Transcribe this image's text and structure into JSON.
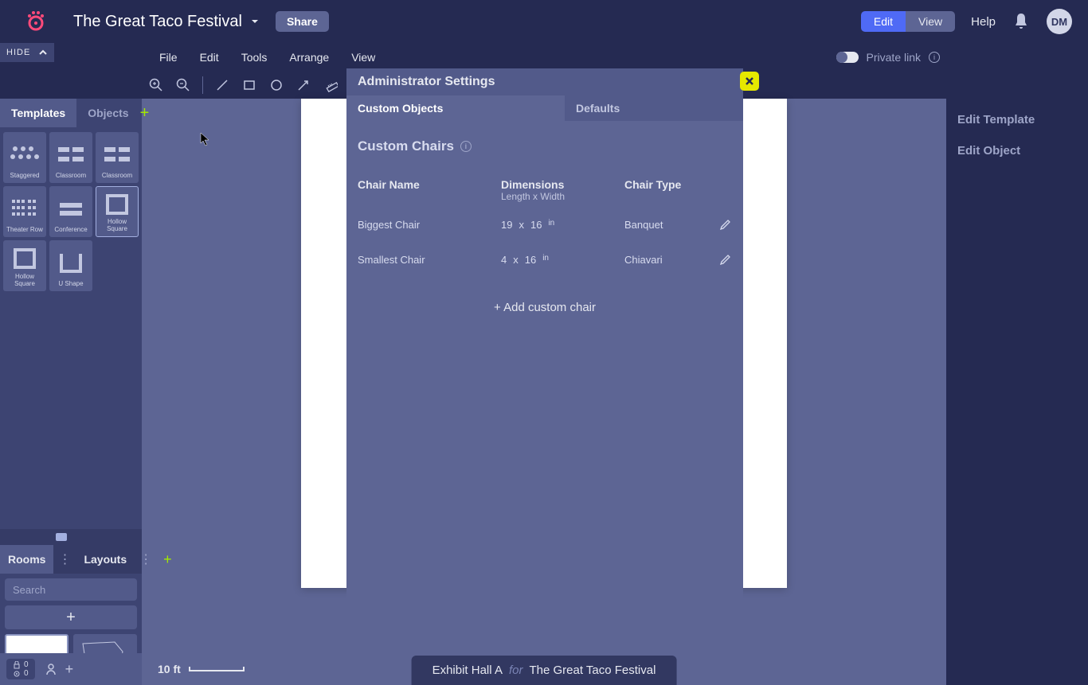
{
  "header": {
    "project_title": "The Great Taco Festival",
    "share": "Share",
    "edit": "Edit",
    "view": "View",
    "help": "Help",
    "avatar": "DM"
  },
  "hide_bar": "HIDE",
  "menu": {
    "file": "File",
    "edit": "Edit",
    "tools": "Tools",
    "arrange": "Arrange",
    "view": "View",
    "private_link": "Private link"
  },
  "sidebar": {
    "tabs": {
      "templates": "Templates",
      "objects": "Objects"
    },
    "templates": {
      "t0": "Staggered",
      "t1": "Classroom",
      "t2": "Classroom",
      "t3": "Theater Row",
      "t4": "Conference",
      "t5": "Hollow Square",
      "t6": "Hollow Square",
      "t7": "U Shape"
    }
  },
  "rooms": {
    "tabs": {
      "rooms": "Rooms",
      "layouts": "Layouts"
    },
    "search_placeholder": "Search"
  },
  "status": {
    "lock": "0",
    "gear": "0"
  },
  "right": {
    "edit_template": "Edit Template",
    "edit_object": "Edit Object"
  },
  "scale": "10 ft",
  "bottom": {
    "room": "Exhibit Hall A",
    "for": "for",
    "event": "The Great Taco Festival"
  },
  "modal": {
    "title": "Administrator Settings",
    "tab_custom": "Custom Objects",
    "tab_defaults": "Defaults",
    "section": "Custom Chairs",
    "col_name": "Chair Name",
    "col_dim": "Dimensions",
    "col_dim_sub": "Length x Width",
    "col_type": "Chair Type",
    "rows": [
      {
        "name": "Biggest Chair",
        "l": "19",
        "x": "x",
        "w": "16",
        "unit": "in",
        "type": "Banquet"
      },
      {
        "name": "Smallest Chair",
        "l": "4",
        "x": "x",
        "w": "16",
        "unit": "in",
        "type": "Chiavari"
      }
    ],
    "add": "+ Add custom chair"
  }
}
